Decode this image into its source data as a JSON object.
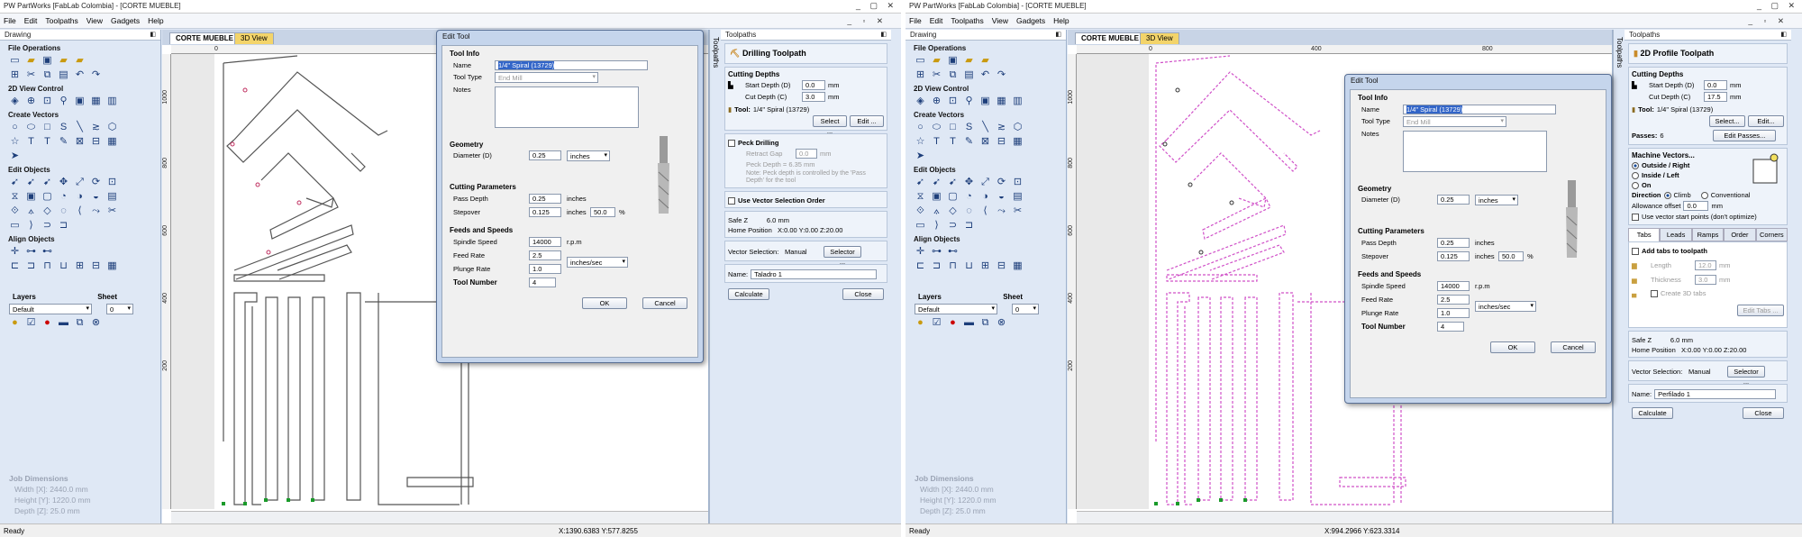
{
  "app": {
    "title": "PartWorks [FabLab Colombia] - [CORTE MUEBLE]",
    "menu": [
      "File",
      "Edit",
      "Toolpaths",
      "View",
      "Gadgets",
      "Help"
    ],
    "status": "Ready"
  },
  "left_panel": {
    "header": "Drawing",
    "sections": {
      "file_ops": "File Operations",
      "view_ctl": "2D View Control",
      "create_vec": "Create Vectors",
      "edit_obj": "Edit Objects",
      "align_obj": "Align Objects"
    },
    "layers_label": "Layers",
    "sheet_label": "Sheet",
    "layer_value": "Default",
    "sheet_value": "0",
    "job_dims": {
      "title": "Job Dimensions",
      "width": "Width  [X]: 2440.0 mm",
      "height": "Height [Y]: 1220.0 mm",
      "depth": "Depth  [Z]: 25.0 mm"
    }
  },
  "canvas": {
    "tab_name": "CORTE MUEBLE",
    "tab_3d": "3D View"
  },
  "left_window": {
    "ruler_x": [
      "0"
    ],
    "ruler_y": [
      "1000",
      "800",
      "600",
      "400",
      "200"
    ],
    "coords": "X:1390.6383 Y:577.8255",
    "toolpath": {
      "panel_title": "Toolpaths",
      "op_name": "Drilling Toolpath",
      "cutting_depths": "Cutting Depths",
      "start_depth_label": "Start Depth (D)",
      "start_depth": "0.0",
      "cut_depth_label": "Cut Depth (C)",
      "cut_depth": "3.0",
      "unit": "mm",
      "tool_label": "Tool:",
      "tool_value": "1/4\" Spiral (13729)",
      "select_btn": "Select ...",
      "edit_btn": "Edit ...",
      "peck_label": "Peck Drilling",
      "retract_label": "Retract Gap",
      "retract_value": "0.0",
      "peck_depth": "Peck Depth = 6.35 mm",
      "note": "Note: Peck depth is controlled by the 'Pass Depth' for the tool",
      "vec_order": "Use Vector Selection Order",
      "safe_z": "Safe Z          6.0 mm",
      "home_pos": "Home Position   X:0.00 Y:0.00 Z:20.00",
      "vec_sel_label": "Vector Selection:",
      "vec_sel_value": "Manual",
      "selector_btn": "Selector ...",
      "name_label": "Name:",
      "name_value": "Taladro 1",
      "calc_btn": "Calculate",
      "close_btn": "Close"
    }
  },
  "right_window": {
    "ruler_x": [
      "0",
      "400",
      "800"
    ],
    "ruler_y": [
      "1000",
      "800",
      "600",
      "400",
      "200"
    ],
    "coords": "X:994.2966 Y:623.3314",
    "toolpath": {
      "panel_title": "Toolpaths",
      "op_name": "2D Profile Toolpath",
      "cutting_depths": "Cutting Depths",
      "start_depth_label": "Start Depth (D)",
      "start_depth": "0.0",
      "cut_depth_label": "Cut Depth (C)",
      "cut_depth": "17.5",
      "unit": "mm",
      "tool_label": "Tool:",
      "tool_value": "1/4\" Spiral (13729)",
      "select_btn": "Select...",
      "edit_btn": "Edit...",
      "passes_label": "Passes:",
      "passes_value": "6",
      "edit_passes_btn": "Edit Passes...",
      "machine_vectors": "Machine Vectors...",
      "outside": "Outside / Right",
      "inside": "Inside / Left",
      "on": "On",
      "direction_label": "Direction",
      "climb": "Climb",
      "conventional": "Conventional",
      "allowance_label": "Allowance offset",
      "allowance_value": "0.0",
      "vec_start": "Use vector start points (don't optimize)",
      "tabs": [
        "Tabs",
        "Leads",
        "Ramps",
        "Order",
        "Corners"
      ],
      "add_tabs": "Add tabs to toolpath",
      "length_label": "Length",
      "length_value": "12.0",
      "thickness_label": "Thickness",
      "thickness_value": "3.0",
      "create3d": "Create 3D tabs",
      "edit_tabs_btn": "Edit Tabs ...",
      "safe_z": "Safe Z          6.0 mm",
      "home_pos": "Home Position   X:0.00 Y:0.00 Z:20.00",
      "vec_sel_label": "Vector Selection:",
      "vec_sel_value": "Manual",
      "selector_btn": "Selector ...",
      "name_label": "Name:",
      "name_value": "Perfilado 1",
      "calc_btn": "Calculate",
      "close_btn": "Close"
    }
  },
  "vtab_label": "Toolpaths",
  "edit_tool": {
    "title": "Edit Tool",
    "tool_info": "Tool Info",
    "name_label": "Name",
    "name_value": "1/4\" Spiral (13729)",
    "type_label": "Tool Type",
    "type_value": "End Mill",
    "notes_label": "Notes",
    "geometry": "Geometry",
    "diameter_label": "Diameter (D)",
    "diameter_value": "0.25",
    "units": "inches",
    "cutting_params": "Cutting Parameters",
    "pass_depth_label": "Pass Depth",
    "pass_depth_value": "0.25",
    "stepover_label": "Stepover",
    "stepover_value": "0.125",
    "stepover_pct": "50.0",
    "pct": "%",
    "inches": "inches",
    "feeds": "Feeds and Speeds",
    "spindle_label": "Spindle Speed",
    "spindle_value": "14000",
    "rpm": "r.p.m",
    "feed_label": "Feed Rate",
    "feed_value": "2.5",
    "plunge_label": "Plunge Rate",
    "plunge_value": "1.0",
    "rate_units": "inches/sec",
    "tool_num_label": "Tool Number",
    "tool_num_value": "4",
    "ok": "OK",
    "cancel": "Cancel"
  },
  "colors": {
    "panel_bg": "#dfe8f5",
    "vector_line": "#555555",
    "selected_vector": "#d050c8",
    "node_green": "#1a9a2a"
  }
}
